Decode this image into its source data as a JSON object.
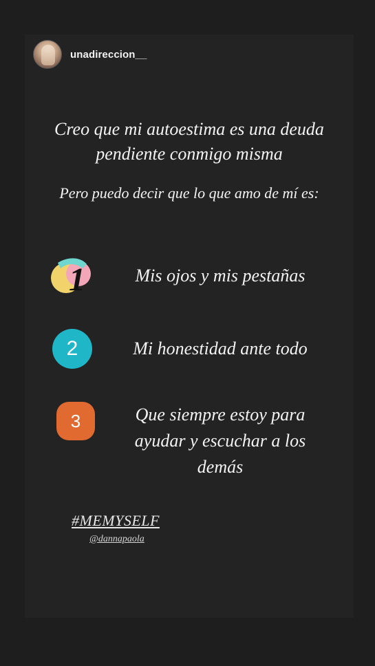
{
  "header": {
    "username": "unadireccion__",
    "avatar_icon": "profile-photo"
  },
  "intro": {
    "line1": "Creo que mi autoestima es una deuda pendiente conmigo misma",
    "line2": "Pero puedo decir que lo que amo de mí es:"
  },
  "items": [
    {
      "number": "1",
      "text": "Mis ojos y mis pestañas",
      "badge_colors": [
        "#f2d36b",
        "#f2a6b8",
        "#6fd6d0",
        "#1a1a1a"
      ]
    },
    {
      "number": "2",
      "text": "Mi honestidad ante todo",
      "badge_color": "#1fb6c8"
    },
    {
      "number": "3",
      "text": "Que siempre estoy para ayudar y escuchar a los demás",
      "badge_color": "#e06a2f"
    }
  ],
  "footer": {
    "hashtag": "#MEMYSELF",
    "mention": "@dannapaola"
  },
  "colors": {
    "background": "#1e1e1e",
    "card": "#232323",
    "text": "#f3f3f3"
  }
}
